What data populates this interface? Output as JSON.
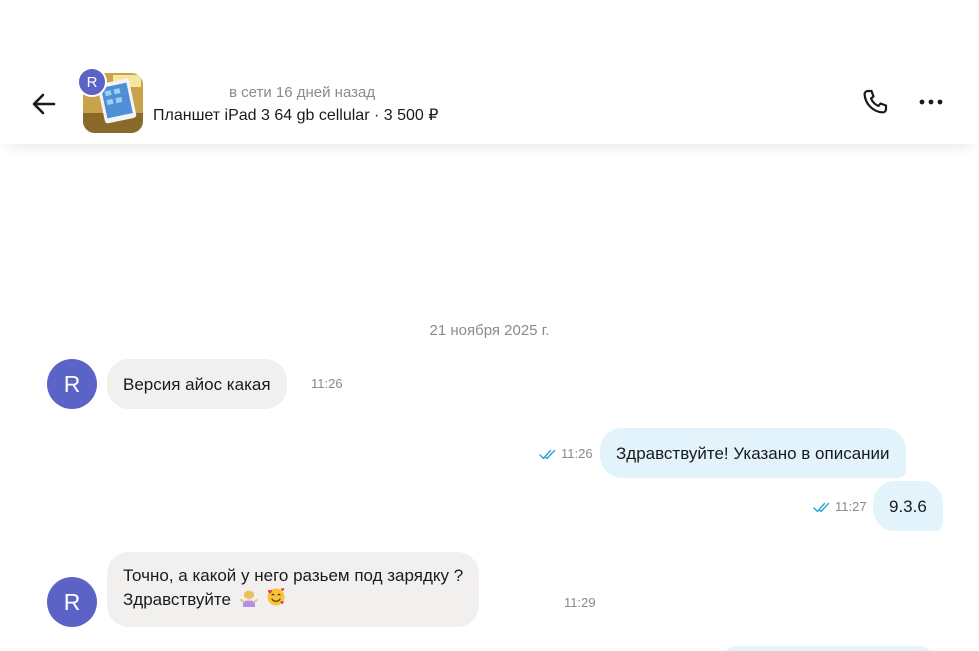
{
  "header": {
    "avatar_letter": "R",
    "status": "в сети 16 дней назад",
    "item_title": "Планшет iPad 3 64 gb cellular · 3 500 ₽"
  },
  "conversation": {
    "date": "21 ноября 2025 г.",
    "messages": [
      {
        "direction": "in",
        "avatar": "R",
        "text": "Версия айос какая",
        "time": "11:26"
      },
      {
        "direction": "out",
        "text": "Здравствуйте! Указано в описании",
        "time": "11:26",
        "status": "read"
      },
      {
        "direction": "out",
        "text": "9.3.6",
        "time": "11:27",
        "status": "read"
      },
      {
        "direction": "in",
        "avatar": "R",
        "line1": "Точно, а какой у него разьем под зарядку ?",
        "line2": "Здравствуйте",
        "time": "11:29"
      }
    ]
  },
  "colors": {
    "avatar": "#5b63c6",
    "incoming_bubble": "#f1f0ef",
    "outgoing_bubble": "#e3f3fc",
    "read_check": "#2aa3d6"
  },
  "icons": [
    "back-arrow-icon",
    "phone-icon",
    "more-dots-icon",
    "double-check-icon",
    "woman-shrugging-emoji",
    "smiling-hearts-emoji"
  ]
}
